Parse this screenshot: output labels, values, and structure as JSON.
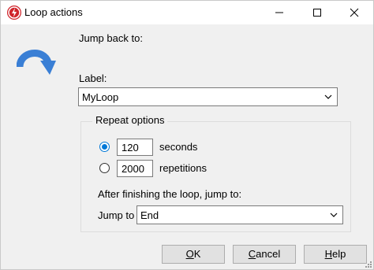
{
  "window": {
    "title": "Loop actions",
    "accent": "#0078d7",
    "icon": "app-bolt-icon"
  },
  "dialog": {
    "jump_back_label": "Jump back to:",
    "label_caption": "Label:",
    "label_value": "MyLoop",
    "big_icon": "loop-back-arrow-icon"
  },
  "repeat": {
    "group_title": "Repeat options",
    "option_seconds": {
      "value": "120",
      "unit": "seconds",
      "selected": true
    },
    "option_repetitions": {
      "value": "2000",
      "unit": "repetitions",
      "selected": false
    },
    "after_label": "After finishing the loop, jump to:",
    "jump_to_label": "Jump to",
    "jump_to_value": "End"
  },
  "buttons": {
    "ok": {
      "mnemonic": "O",
      "rest": "K"
    },
    "cancel": {
      "mnemonic": "C",
      "rest": "ancel"
    },
    "help": {
      "mnemonic": "H",
      "rest": "elp"
    }
  }
}
